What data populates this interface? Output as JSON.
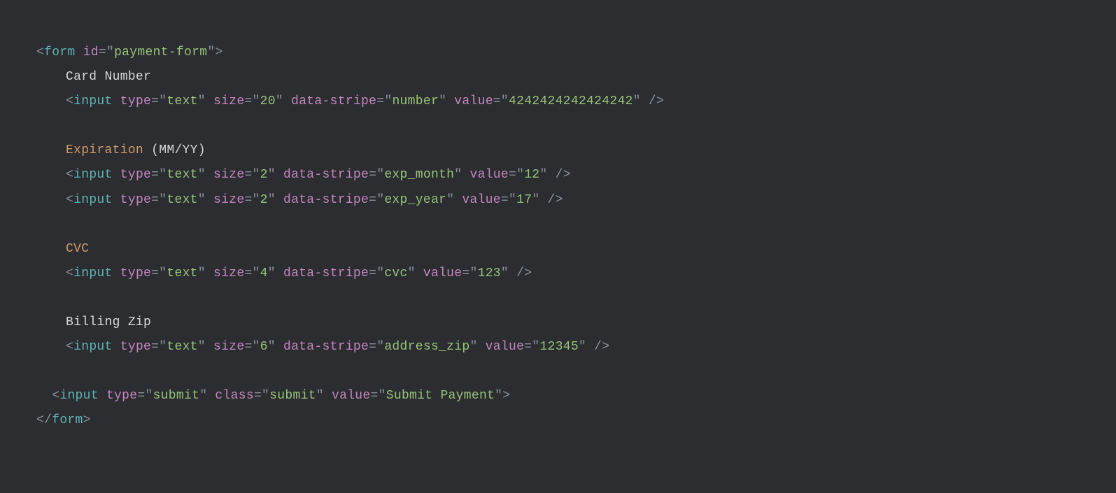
{
  "lines": [
    {
      "indent": 0,
      "tokens": [
        {
          "cls": "punct",
          "t": "<"
        },
        {
          "cls": "tag-name",
          "t": "form"
        },
        {
          "cls": "punct",
          "t": " "
        },
        {
          "cls": "attr-name",
          "t": "id"
        },
        {
          "cls": "punct",
          "t": "="
        },
        {
          "cls": "punct",
          "t": "\""
        },
        {
          "cls": "attr-value",
          "t": "payment-form"
        },
        {
          "cls": "punct",
          "t": "\""
        },
        {
          "cls": "punct",
          "t": ">"
        }
      ]
    },
    {
      "indent": 1,
      "tokens": [
        {
          "cls": "text-plain",
          "t": "Card Number"
        }
      ]
    },
    {
      "indent": 1,
      "tokens": [
        {
          "cls": "punct",
          "t": "<"
        },
        {
          "cls": "tag-name",
          "t": "input"
        },
        {
          "cls": "punct",
          "t": " "
        },
        {
          "cls": "attr-name",
          "t": "type"
        },
        {
          "cls": "punct",
          "t": "="
        },
        {
          "cls": "punct",
          "t": "\""
        },
        {
          "cls": "attr-value",
          "t": "text"
        },
        {
          "cls": "punct",
          "t": "\" "
        },
        {
          "cls": "attr-name",
          "t": "size"
        },
        {
          "cls": "punct",
          "t": "="
        },
        {
          "cls": "punct",
          "t": "\""
        },
        {
          "cls": "attr-value",
          "t": "20"
        },
        {
          "cls": "punct",
          "t": "\" "
        },
        {
          "cls": "attr-name",
          "t": "data-stripe"
        },
        {
          "cls": "punct",
          "t": "="
        },
        {
          "cls": "punct",
          "t": "\""
        },
        {
          "cls": "attr-value",
          "t": "number"
        },
        {
          "cls": "punct",
          "t": "\" "
        },
        {
          "cls": "attr-name",
          "t": "value"
        },
        {
          "cls": "punct",
          "t": "="
        },
        {
          "cls": "punct",
          "t": "\""
        },
        {
          "cls": "attr-value",
          "t": "4242424242424242"
        },
        {
          "cls": "punct",
          "t": "\" />"
        }
      ]
    },
    {
      "indent": 0,
      "tokens": []
    },
    {
      "indent": 1,
      "tokens": [
        {
          "cls": "text-orange",
          "t": "Expiration"
        },
        {
          "cls": "text-plain",
          "t": " (MM/YY)"
        }
      ]
    },
    {
      "indent": 1,
      "tokens": [
        {
          "cls": "punct",
          "t": "<"
        },
        {
          "cls": "tag-name",
          "t": "input"
        },
        {
          "cls": "punct",
          "t": " "
        },
        {
          "cls": "attr-name",
          "t": "type"
        },
        {
          "cls": "punct",
          "t": "="
        },
        {
          "cls": "punct",
          "t": "\""
        },
        {
          "cls": "attr-value",
          "t": "text"
        },
        {
          "cls": "punct",
          "t": "\" "
        },
        {
          "cls": "attr-name",
          "t": "size"
        },
        {
          "cls": "punct",
          "t": "="
        },
        {
          "cls": "punct",
          "t": "\""
        },
        {
          "cls": "attr-value",
          "t": "2"
        },
        {
          "cls": "punct",
          "t": "\" "
        },
        {
          "cls": "attr-name",
          "t": "data-stripe"
        },
        {
          "cls": "punct",
          "t": "="
        },
        {
          "cls": "punct",
          "t": "\""
        },
        {
          "cls": "attr-value",
          "t": "exp_month"
        },
        {
          "cls": "punct",
          "t": "\" "
        },
        {
          "cls": "attr-name",
          "t": "value"
        },
        {
          "cls": "punct",
          "t": "="
        },
        {
          "cls": "punct",
          "t": "\""
        },
        {
          "cls": "attr-value",
          "t": "12"
        },
        {
          "cls": "punct",
          "t": "\" />"
        }
      ]
    },
    {
      "indent": 1,
      "tokens": [
        {
          "cls": "punct",
          "t": "<"
        },
        {
          "cls": "tag-name",
          "t": "input"
        },
        {
          "cls": "punct",
          "t": " "
        },
        {
          "cls": "attr-name",
          "t": "type"
        },
        {
          "cls": "punct",
          "t": "="
        },
        {
          "cls": "punct",
          "t": "\""
        },
        {
          "cls": "attr-value",
          "t": "text"
        },
        {
          "cls": "punct",
          "t": "\" "
        },
        {
          "cls": "attr-name",
          "t": "size"
        },
        {
          "cls": "punct",
          "t": "="
        },
        {
          "cls": "punct",
          "t": "\""
        },
        {
          "cls": "attr-value",
          "t": "2"
        },
        {
          "cls": "punct",
          "t": "\" "
        },
        {
          "cls": "attr-name",
          "t": "data-stripe"
        },
        {
          "cls": "punct",
          "t": "="
        },
        {
          "cls": "punct",
          "t": "\""
        },
        {
          "cls": "attr-value",
          "t": "exp_year"
        },
        {
          "cls": "punct",
          "t": "\" "
        },
        {
          "cls": "attr-name",
          "t": "value"
        },
        {
          "cls": "punct",
          "t": "="
        },
        {
          "cls": "punct",
          "t": "\""
        },
        {
          "cls": "attr-value",
          "t": "17"
        },
        {
          "cls": "punct",
          "t": "\" />"
        }
      ]
    },
    {
      "indent": 0,
      "tokens": []
    },
    {
      "indent": 1,
      "tokens": [
        {
          "cls": "text-orange",
          "t": "CVC"
        }
      ]
    },
    {
      "indent": 1,
      "tokens": [
        {
          "cls": "punct",
          "t": "<"
        },
        {
          "cls": "tag-name",
          "t": "input"
        },
        {
          "cls": "punct",
          "t": " "
        },
        {
          "cls": "attr-name",
          "t": "type"
        },
        {
          "cls": "punct",
          "t": "="
        },
        {
          "cls": "punct",
          "t": "\""
        },
        {
          "cls": "attr-value",
          "t": "text"
        },
        {
          "cls": "punct",
          "t": "\" "
        },
        {
          "cls": "attr-name",
          "t": "size"
        },
        {
          "cls": "punct",
          "t": "="
        },
        {
          "cls": "punct",
          "t": "\""
        },
        {
          "cls": "attr-value",
          "t": "4"
        },
        {
          "cls": "punct",
          "t": "\" "
        },
        {
          "cls": "attr-name",
          "t": "data-stripe"
        },
        {
          "cls": "punct",
          "t": "="
        },
        {
          "cls": "punct",
          "t": "\""
        },
        {
          "cls": "attr-value",
          "t": "cvc"
        },
        {
          "cls": "punct",
          "t": "\" "
        },
        {
          "cls": "attr-name",
          "t": "value"
        },
        {
          "cls": "punct",
          "t": "="
        },
        {
          "cls": "punct",
          "t": "\""
        },
        {
          "cls": "attr-value",
          "t": "123"
        },
        {
          "cls": "punct",
          "t": "\" />"
        }
      ]
    },
    {
      "indent": 0,
      "tokens": []
    },
    {
      "indent": 1,
      "tokens": [
        {
          "cls": "text-plain",
          "t": "Billing Zip"
        }
      ]
    },
    {
      "indent": 1,
      "tokens": [
        {
          "cls": "punct",
          "t": "<"
        },
        {
          "cls": "tag-name",
          "t": "input"
        },
        {
          "cls": "punct",
          "t": " "
        },
        {
          "cls": "attr-name",
          "t": "type"
        },
        {
          "cls": "punct",
          "t": "="
        },
        {
          "cls": "punct",
          "t": "\""
        },
        {
          "cls": "attr-value",
          "t": "text"
        },
        {
          "cls": "punct",
          "t": "\" "
        },
        {
          "cls": "attr-name",
          "t": "size"
        },
        {
          "cls": "punct",
          "t": "="
        },
        {
          "cls": "punct",
          "t": "\""
        },
        {
          "cls": "attr-value",
          "t": "6"
        },
        {
          "cls": "punct",
          "t": "\" "
        },
        {
          "cls": "attr-name",
          "t": "data-stripe"
        },
        {
          "cls": "punct",
          "t": "="
        },
        {
          "cls": "punct",
          "t": "\""
        },
        {
          "cls": "attr-value",
          "t": "address_zip"
        },
        {
          "cls": "punct",
          "t": "\" "
        },
        {
          "cls": "attr-name",
          "t": "value"
        },
        {
          "cls": "punct",
          "t": "="
        },
        {
          "cls": "punct",
          "t": "\""
        },
        {
          "cls": "attr-value",
          "t": "12345"
        },
        {
          "cls": "punct",
          "t": "\" />"
        }
      ]
    },
    {
      "indent": 0,
      "tokens": []
    },
    {
      "indent": 0,
      "tokens": [
        {
          "cls": "punct",
          "t": "  <"
        },
        {
          "cls": "tag-name",
          "t": "input"
        },
        {
          "cls": "punct",
          "t": " "
        },
        {
          "cls": "attr-name",
          "t": "type"
        },
        {
          "cls": "punct",
          "t": "="
        },
        {
          "cls": "punct",
          "t": "\""
        },
        {
          "cls": "attr-value",
          "t": "submit"
        },
        {
          "cls": "punct",
          "t": "\" "
        },
        {
          "cls": "attr-name",
          "t": "class"
        },
        {
          "cls": "punct",
          "t": "="
        },
        {
          "cls": "punct",
          "t": "\""
        },
        {
          "cls": "attr-value",
          "t": "submit"
        },
        {
          "cls": "punct",
          "t": "\" "
        },
        {
          "cls": "attr-name",
          "t": "value"
        },
        {
          "cls": "punct",
          "t": "="
        },
        {
          "cls": "punct",
          "t": "\""
        },
        {
          "cls": "attr-value",
          "t": "Submit Payment"
        },
        {
          "cls": "punct",
          "t": "\">"
        }
      ]
    },
    {
      "indent": 0,
      "tokens": [
        {
          "cls": "punct",
          "t": "</"
        },
        {
          "cls": "tag-name",
          "t": "form"
        },
        {
          "cls": "punct",
          "t": ">"
        }
      ]
    }
  ]
}
